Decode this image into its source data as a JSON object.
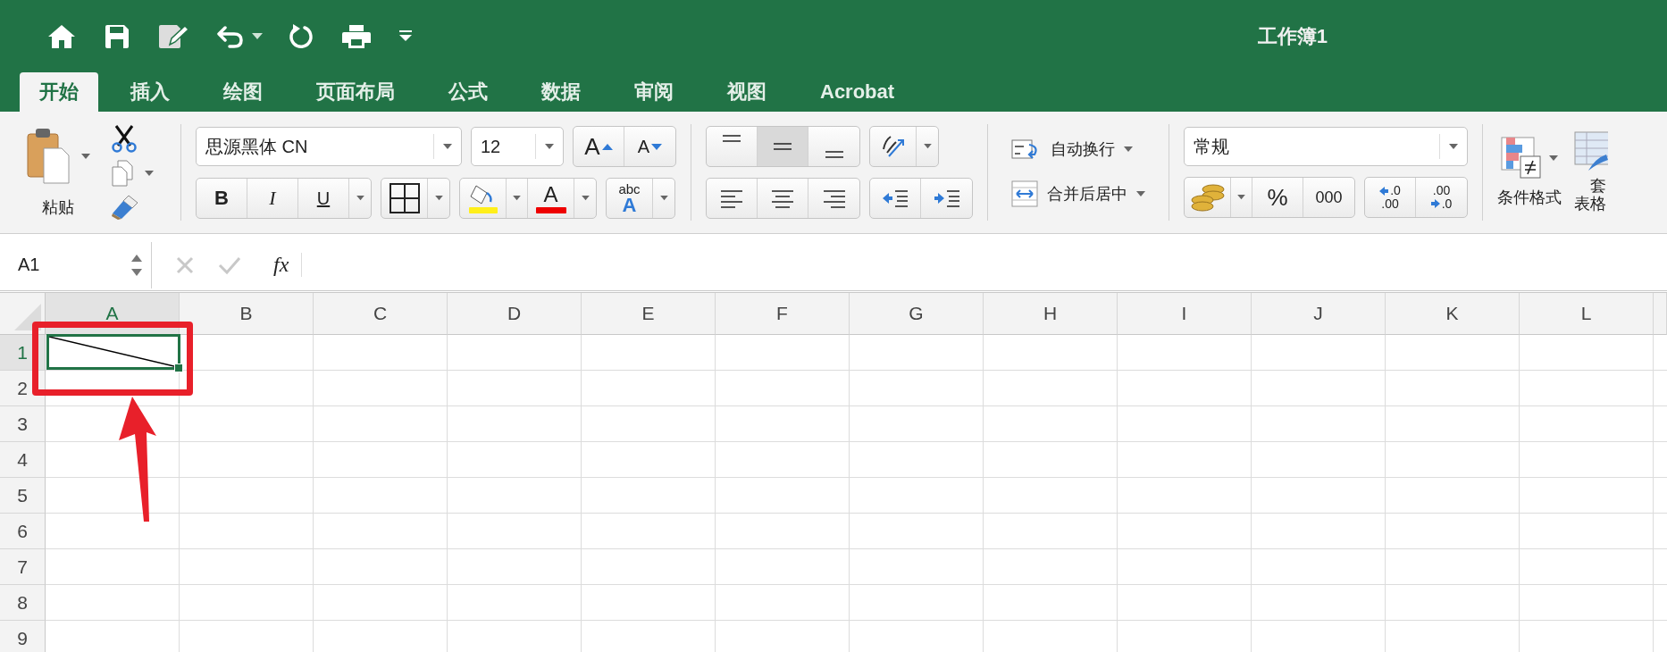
{
  "window": {
    "title": "工作簿1"
  },
  "tabs": [
    {
      "label": "开始",
      "selected": true
    },
    {
      "label": "插入",
      "selected": false
    },
    {
      "label": "绘图",
      "selected": false
    },
    {
      "label": "页面布局",
      "selected": false
    },
    {
      "label": "公式",
      "selected": false
    },
    {
      "label": "数据",
      "selected": false
    },
    {
      "label": "审阅",
      "selected": false
    },
    {
      "label": "视图",
      "selected": false
    },
    {
      "label": "Acrobat",
      "selected": false
    }
  ],
  "ribbon": {
    "paste_label": "粘贴",
    "font_name": "思源黑体 CN",
    "font_size": "12",
    "font_grow": "A",
    "font_shrink": "A",
    "bold": "B",
    "italic": "I",
    "underline": "U",
    "font_color": "A",
    "text_effects": {
      "top": "abc",
      "letter": "A"
    },
    "vertical_align": [
      {
        "selected": false
      },
      {
        "selected": true
      },
      {
        "selected": false
      }
    ],
    "wrap_text": "自动换行",
    "merge_center": "合并后居中",
    "number_format": "常规",
    "percent": "%",
    "thousands": "000",
    "decimal_increase": {
      "top": ".0",
      "bottom": ".00"
    },
    "decimal_decrease": {
      "top": ".00",
      "bottom": ".0"
    },
    "conditional_format": "条件格式",
    "format_table": [
      "套",
      "表格"
    ]
  },
  "formula_bar": {
    "cell_ref": "A1",
    "fx": "fx"
  },
  "sheet": {
    "columns": [
      {
        "label": "A",
        "selected": true
      },
      {
        "label": "B",
        "selected": false
      },
      {
        "label": "C",
        "selected": false
      },
      {
        "label": "D",
        "selected": false
      },
      {
        "label": "E",
        "selected": false
      },
      {
        "label": "F",
        "selected": false
      },
      {
        "label": "G",
        "selected": false
      },
      {
        "label": "H",
        "selected": false
      },
      {
        "label": "I",
        "selected": false
      },
      {
        "label": "J",
        "selected": false
      },
      {
        "label": "K",
        "selected": false
      },
      {
        "label": "L",
        "selected": false
      }
    ],
    "rows": [
      {
        "label": "1",
        "selected": true
      },
      {
        "label": "2",
        "selected": false
      },
      {
        "label": "3",
        "selected": false
      },
      {
        "label": "4",
        "selected": false
      },
      {
        "label": "5",
        "selected": false
      },
      {
        "label": "6",
        "selected": false
      },
      {
        "label": "7",
        "selected": false
      },
      {
        "label": "8",
        "selected": false
      },
      {
        "label": "9",
        "selected": false
      }
    ],
    "active_cell": {
      "diagonal_border": true
    }
  }
}
